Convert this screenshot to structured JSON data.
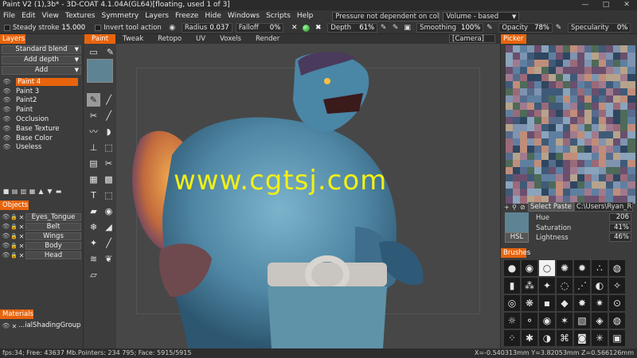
{
  "window": {
    "title": "Paint V2 (1),3b* - 3D-COAT 4.1.04A(GL64)[floating, used 1 of 3]",
    "controls": [
      "—",
      "□",
      "✕"
    ]
  },
  "menu": {
    "items": [
      "File",
      "Edit",
      "View",
      "Textures",
      "Symmetry",
      "Layers",
      "Freeze",
      "Hide",
      "Windows",
      "Scripts",
      "Help"
    ],
    "pressure_combo": "Pressure not dependent on colo",
    "volume_combo": "Volume - based"
  },
  "toolbar": {
    "steady_stroke_label": "Steady stroke",
    "steady_stroke_value": "15.000",
    "invert_label": "Invert tool action",
    "radius_label": "Radius",
    "radius_value": "0.037",
    "falloff_label": "Falloff",
    "falloff_value": "0%",
    "depth_label": "Depth",
    "depth_value": "61%",
    "smoothing_label": "Smoothing",
    "smoothing_value": "100%",
    "opacity_label": "Opacity",
    "opacity_value": "78%",
    "specularity_label": "Specularity",
    "specularity_value": "0%"
  },
  "tabs": {
    "items": [
      "Paint",
      "Tweak",
      "Retopo",
      "UV",
      "Voxels",
      "Render"
    ],
    "active": "Paint",
    "camera": "[Camera]"
  },
  "layers": {
    "header": "Layers",
    "blend_mode": "Standard blend",
    "add_depth": "Add depth",
    "add": "Add",
    "items": [
      "Paint 4",
      "Paint 3",
      "Paint2",
      "Paint",
      "Occlusion",
      "Base Texture",
      "Base Color",
      "Useless"
    ],
    "selected": "Paint 4"
  },
  "objects": {
    "header": "Objects",
    "items": [
      "Eyes_Tongue",
      "Belt",
      "Wings",
      "Body",
      "Head"
    ]
  },
  "materials": {
    "header": "Materials",
    "items": [
      "...ialShadingGroup"
    ]
  },
  "viewport": {
    "watermark": "www.cgtsj.com"
  },
  "picker": {
    "header": "Picker",
    "select_paste": "Select Paste",
    "path": "C:\\Users\\Ryan_R",
    "hsl_button": "HSL",
    "hue_label": "Hue",
    "hue_value": "206",
    "saturation_label": "Saturation",
    "saturation_value": "41%",
    "lightness_label": "Lightness",
    "lightness_value": "46%",
    "current_color": "#5e8494"
  },
  "brushes": {
    "header": "Brushes"
  },
  "status": {
    "left": "fps:34;   Free: 43637 Mb.Pointers: 234 795; Face: 5915/5915",
    "right": "X=-0.540313mm  Y=3.82053mm  Z=0.566126mm"
  },
  "colors": {
    "accent": "#e8640c",
    "watermark": "#f3f014"
  }
}
